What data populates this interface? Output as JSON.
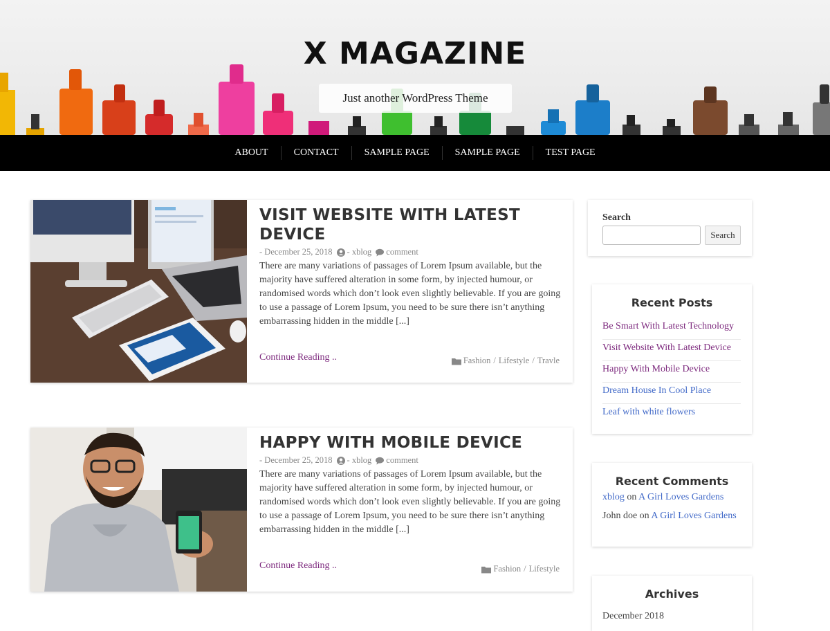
{
  "header": {
    "site_title": "X MAGAZINE",
    "tagline": "Just another WordPress Theme"
  },
  "nav": {
    "items": [
      "ABOUT",
      "CONTACT",
      "SAMPLE PAGE",
      "SAMPLE PAGE",
      "TEST PAGE"
    ]
  },
  "posts": [
    {
      "title_line1": "VISIT WEBSITE WITH LATEST",
      "title_line2": "DEVICE",
      "date": "- December 25, 2018",
      "author": "- xblog",
      "comment": "comment",
      "excerpt": "There are many variations of passages of Lorem Ipsum available, but the majority have suffered alteration in some form, by injected humour, or randomised words which don’t look even slightly believable. If you are going to use a passage of Lorem Ipsum, you need to be sure there isn’t anything embarrassing hidden in the middle [...]",
      "read_more": "Continue Reading ..",
      "categories": [
        "Fashion",
        "Lifestyle",
        "Travle"
      ]
    },
    {
      "title_line1": "HAPPY WITH MOBILE DEVICE",
      "date": "- December 25, 2018",
      "author": "- xblog",
      "comment": "comment",
      "excerpt": "There are many variations of passages of Lorem Ipsum available, but the majority have suffered alteration in some form, by injected humour, or randomised words which don’t look even slightly believable. If you are going to use a passage of Lorem Ipsum, you need to be sure there isn’t anything embarrassing hidden in the middle [...]",
      "read_more": "Continue Reading ..",
      "categories": [
        "Fashion",
        "Lifestyle"
      ]
    }
  ],
  "sidebar": {
    "search": {
      "label": "Search",
      "button": "Search",
      "value": ""
    },
    "recent_posts": {
      "title": "Recent Posts",
      "items": [
        "Be Smart With Latest Technology",
        "Visit Website With Latest Device",
        "Happy With Mobile Device",
        "Dream House In Cool Place",
        "Leaf with white flowers"
      ]
    },
    "recent_comments": {
      "title": "Recent Comments",
      "items": [
        {
          "author": "xblog",
          "on": "on",
          "post": "A Girl Loves Gardens"
        },
        {
          "author": "John doe",
          "on": "on",
          "post": "A Girl Loves Gardens"
        }
      ]
    },
    "archives": {
      "title": "Archives",
      "items": [
        "December 2018"
      ]
    }
  },
  "colors": {
    "nav_bg": "#000000",
    "link_purple": "#7d2a7e",
    "link_blue": "#4169c8"
  }
}
